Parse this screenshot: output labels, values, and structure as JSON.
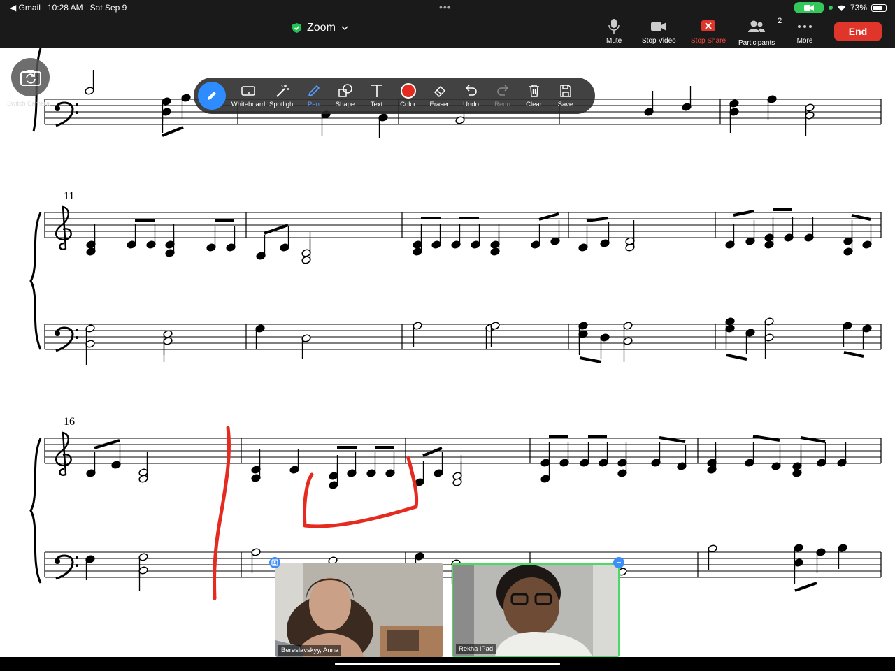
{
  "status_bar": {
    "back_app": "◀ Gmail",
    "time": "10:28 AM",
    "date": "Sat Sep 9",
    "battery": "73%",
    "battery_level": 0.73
  },
  "meeting": {
    "title": "Zoom"
  },
  "toolbar": {
    "mute": "Mute",
    "stop_video": "Stop Video",
    "stop_share": "Stop Share",
    "participants": "Participants",
    "participants_count": "2",
    "more": "More",
    "end": "End"
  },
  "switch_camera": {
    "label": "Switch Camera"
  },
  "annotation": {
    "whiteboard": "Whiteboard",
    "spotlight": "Spotlight",
    "pen": "Pen",
    "shape": "Shape",
    "text": "Text",
    "color": "Color",
    "eraser": "Eraser",
    "undo": "Undo",
    "redo": "Redo",
    "clear": "Clear",
    "save": "Save",
    "selected_color": "#e52b20"
  },
  "score": {
    "measure_number_1": "11",
    "measure_number_2": "16"
  },
  "videos": [
    {
      "name": "Bereslavskyy, Anna"
    },
    {
      "name": "Rekha iPad"
    }
  ],
  "colors": {
    "accent": "#2d8cff",
    "end": "#e0352b",
    "annotation_red": "#e52b20",
    "active_speaker": "#4cd964"
  }
}
